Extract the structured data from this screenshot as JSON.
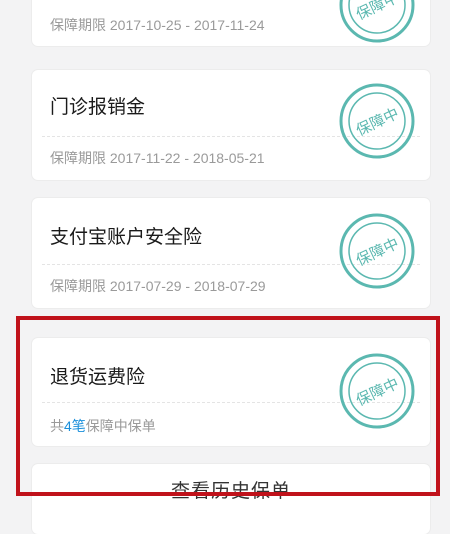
{
  "policies": [
    {
      "title": "",
      "period": "保障期限 2017-10-25 - 2017-11-24",
      "stamp": "保障中"
    },
    {
      "title": "门诊报销金",
      "period": "保障期限 2017-11-22 - 2018-05-21",
      "stamp": "保障中"
    },
    {
      "title": "支付宝账户安全险",
      "period": "保障期限 2017-07-29 - 2018-07-29",
      "stamp": "保障中"
    },
    {
      "title": "退货运费险",
      "count_prefix": "共",
      "count_num": "4笔",
      "count_suffix": "保障中保单",
      "stamp": "保障中"
    }
  ],
  "history_button": "查看历史保单",
  "colors": {
    "stamp": "#5bb8b0",
    "accent": "#1a8fdb",
    "highlight": "#c0121b"
  }
}
